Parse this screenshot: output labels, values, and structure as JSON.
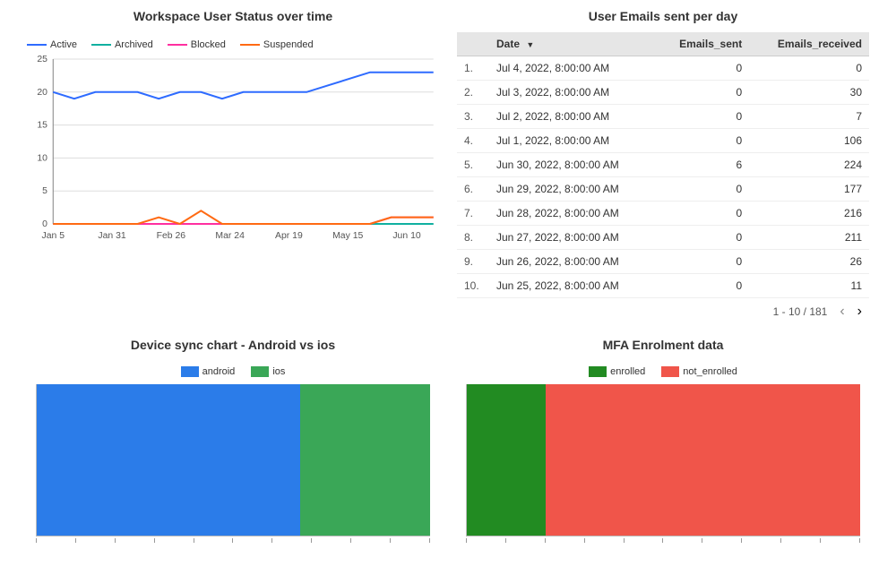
{
  "colors": {
    "active": "#2e6bff",
    "archived": "#10b0a0",
    "blocked": "#ff2fa0",
    "suspended": "#ff6a13",
    "android": "#2b7ce9",
    "ios": "#3aa757",
    "enrolled": "#228b22",
    "not_enrolled": "#f0554a"
  },
  "panel1": {
    "title": "Workspace User Status over time",
    "legend": [
      "Active",
      "Archived",
      "Blocked",
      "Suspended"
    ]
  },
  "panel2": {
    "title": "User Emails sent per day",
    "headers": {
      "idx": "",
      "date": "Date",
      "sent": "Emails_sent",
      "recv": "Emails_received"
    },
    "pager": {
      "range": "1 - 10 / 181"
    }
  },
  "panel3": {
    "title": "Device sync chart - Android vs ios",
    "legend": [
      "android",
      "ios"
    ]
  },
  "panel4": {
    "title": "MFA Enrolment data",
    "legend": [
      "enrolled",
      "not_enrolled"
    ]
  },
  "email_rows": [
    {
      "idx": "1.",
      "date": "Jul 4, 2022, 8:00:00 AM",
      "sent": 0,
      "recv": 0
    },
    {
      "idx": "2.",
      "date": "Jul 3, 2022, 8:00:00 AM",
      "sent": 0,
      "recv": 30
    },
    {
      "idx": "3.",
      "date": "Jul 2, 2022, 8:00:00 AM",
      "sent": 0,
      "recv": 7
    },
    {
      "idx": "4.",
      "date": "Jul 1, 2022, 8:00:00 AM",
      "sent": 0,
      "recv": 106
    },
    {
      "idx": "5.",
      "date": "Jun 30, 2022, 8:00:00 AM",
      "sent": 6,
      "recv": 224
    },
    {
      "idx": "6.",
      "date": "Jun 29, 2022, 8:00:00 AM",
      "sent": 0,
      "recv": 177
    },
    {
      "idx": "7.",
      "date": "Jun 28, 2022, 8:00:00 AM",
      "sent": 0,
      "recv": 216
    },
    {
      "idx": "8.",
      "date": "Jun 27, 2022, 8:00:00 AM",
      "sent": 0,
      "recv": 211
    },
    {
      "idx": "9.",
      "date": "Jun 26, 2022, 8:00:00 AM",
      "sent": 0,
      "recv": 26
    },
    {
      "idx": "10.",
      "date": "Jun 25, 2022, 8:00:00 AM",
      "sent": 0,
      "recv": 11
    }
  ],
  "chart_data": [
    {
      "id": "user_status",
      "type": "line",
      "title": "Workspace User Status over time",
      "x_ticks": [
        "Jan 5",
        "Jan 31",
        "Feb 26",
        "Mar 24",
        "Apr 19",
        "May 15",
        "Jun 10"
      ],
      "y_ticks": [
        0,
        5,
        10,
        15,
        20,
        25
      ],
      "ylim": [
        0,
        25
      ],
      "series": [
        {
          "name": "Active",
          "color": "#2e6bff",
          "values": [
            20,
            19,
            20,
            20,
            20,
            19,
            20,
            20,
            19,
            20,
            20,
            20,
            20,
            21,
            22,
            23,
            23,
            23,
            23
          ]
        },
        {
          "name": "Archived",
          "color": "#10b0a0",
          "values": [
            0,
            0,
            0,
            0,
            0,
            0,
            0,
            0,
            0,
            0,
            0,
            0,
            0,
            0,
            0,
            0,
            0,
            0,
            0
          ]
        },
        {
          "name": "Blocked",
          "color": "#ff2fa0",
          "values": [
            0,
            0,
            0,
            0,
            0,
            0,
            0,
            0,
            0,
            0,
            0,
            0,
            0,
            0,
            0,
            0,
            1,
            1,
            1
          ]
        },
        {
          "name": "Suspended",
          "color": "#ff6a13",
          "values": [
            0,
            0,
            0,
            0,
            0,
            1,
            0,
            2,
            0,
            0,
            0,
            0,
            0,
            0,
            0,
            0,
            1,
            1,
            1
          ]
        }
      ]
    },
    {
      "id": "emails_table",
      "type": "table",
      "title": "User Emails sent per day",
      "columns": [
        "Date",
        "Emails_sent",
        "Emails_received"
      ],
      "rows": [
        [
          "Jul 4, 2022, 8:00:00 AM",
          0,
          0
        ],
        [
          "Jul 3, 2022, 8:00:00 AM",
          0,
          30
        ],
        [
          "Jul 2, 2022, 8:00:00 AM",
          0,
          7
        ],
        [
          "Jul 1, 2022, 8:00:00 AM",
          0,
          106
        ],
        [
          "Jun 30, 2022, 8:00:00 AM",
          6,
          224
        ],
        [
          "Jun 29, 2022, 8:00:00 AM",
          0,
          177
        ],
        [
          "Jun 28, 2022, 8:00:00 AM",
          0,
          216
        ],
        [
          "Jun 27, 2022, 8:00:00 AM",
          0,
          211
        ],
        [
          "Jun 26, 2022, 8:00:00 AM",
          0,
          26
        ],
        [
          "Jun 25, 2022, 8:00:00 AM",
          0,
          11
        ]
      ],
      "page": "1 - 10 / 181"
    },
    {
      "id": "device_sync",
      "type": "bar",
      "title": "Device sync chart - Android vs ios",
      "categories": [
        "android",
        "ios"
      ],
      "values": [
        67,
        33
      ],
      "unit": "percent"
    },
    {
      "id": "mfa_enrolment",
      "type": "bar",
      "title": "MFA Enrolment data",
      "categories": [
        "enrolled",
        "not_enrolled"
      ],
      "values": [
        20,
        80
      ],
      "unit": "percent"
    }
  ]
}
